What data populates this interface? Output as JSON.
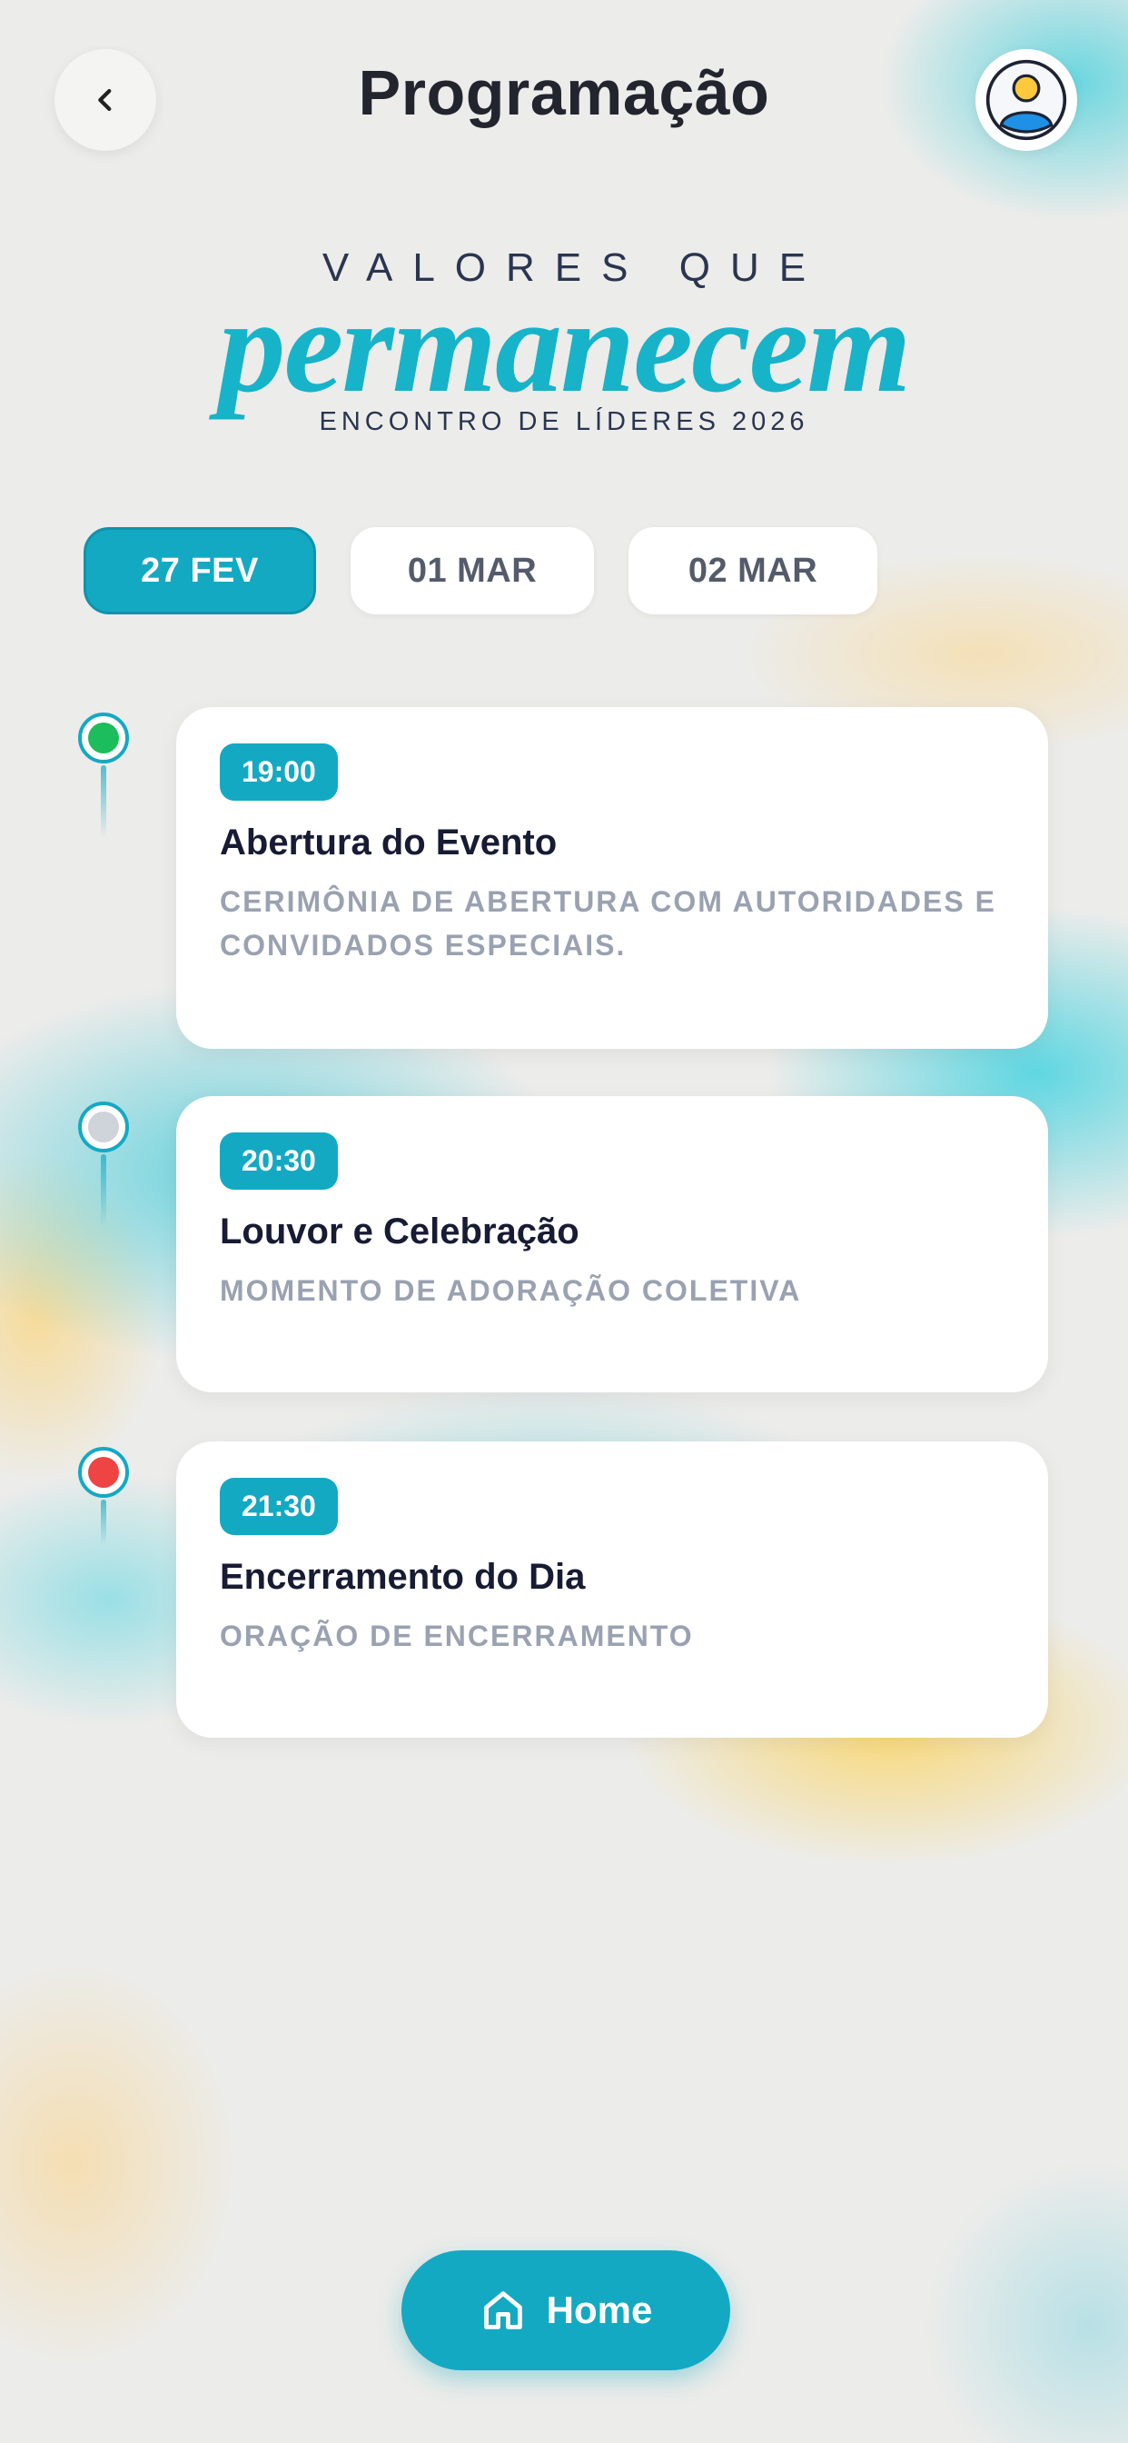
{
  "header": {
    "title": "Programação",
    "back_icon": "chevron-left-icon",
    "avatar_icon": "user-avatar-icon"
  },
  "logo": {
    "top": "VALORES QUE",
    "main": "permanecem",
    "subtitle": "ENCONTRO DE LÍDERES 2026"
  },
  "tabs": [
    {
      "label": "27 FEV",
      "active": true
    },
    {
      "label": "01 MAR",
      "active": false
    },
    {
      "label": "02 MAR",
      "active": false
    }
  ],
  "events": [
    {
      "time": "19:00",
      "title": "Abertura do Evento",
      "desc": "CERIMÔNIA DE ABERTURA COM AUTORIDADES E CONVIDADOS ESPECIAIS.",
      "status_color": "#1bbd5c"
    },
    {
      "time": "20:30",
      "title": "Louvor e Celebração",
      "desc": "MOMENTO DE ADORAÇÃO COLETIVA",
      "status_color": "#cfd3da"
    },
    {
      "time": "21:30",
      "title": "Encerramento do Dia",
      "desc": "ORAÇÃO DE ENCERRAMENTO",
      "status_color": "#ef4444"
    }
  ],
  "bottom_nav": {
    "home_label": "Home",
    "home_icon": "home-icon"
  },
  "colors": {
    "accent": "#14a9c3",
    "logo": "#17b3c9",
    "dark_text": "#171b33",
    "muted_text": "#9aa2b1"
  }
}
